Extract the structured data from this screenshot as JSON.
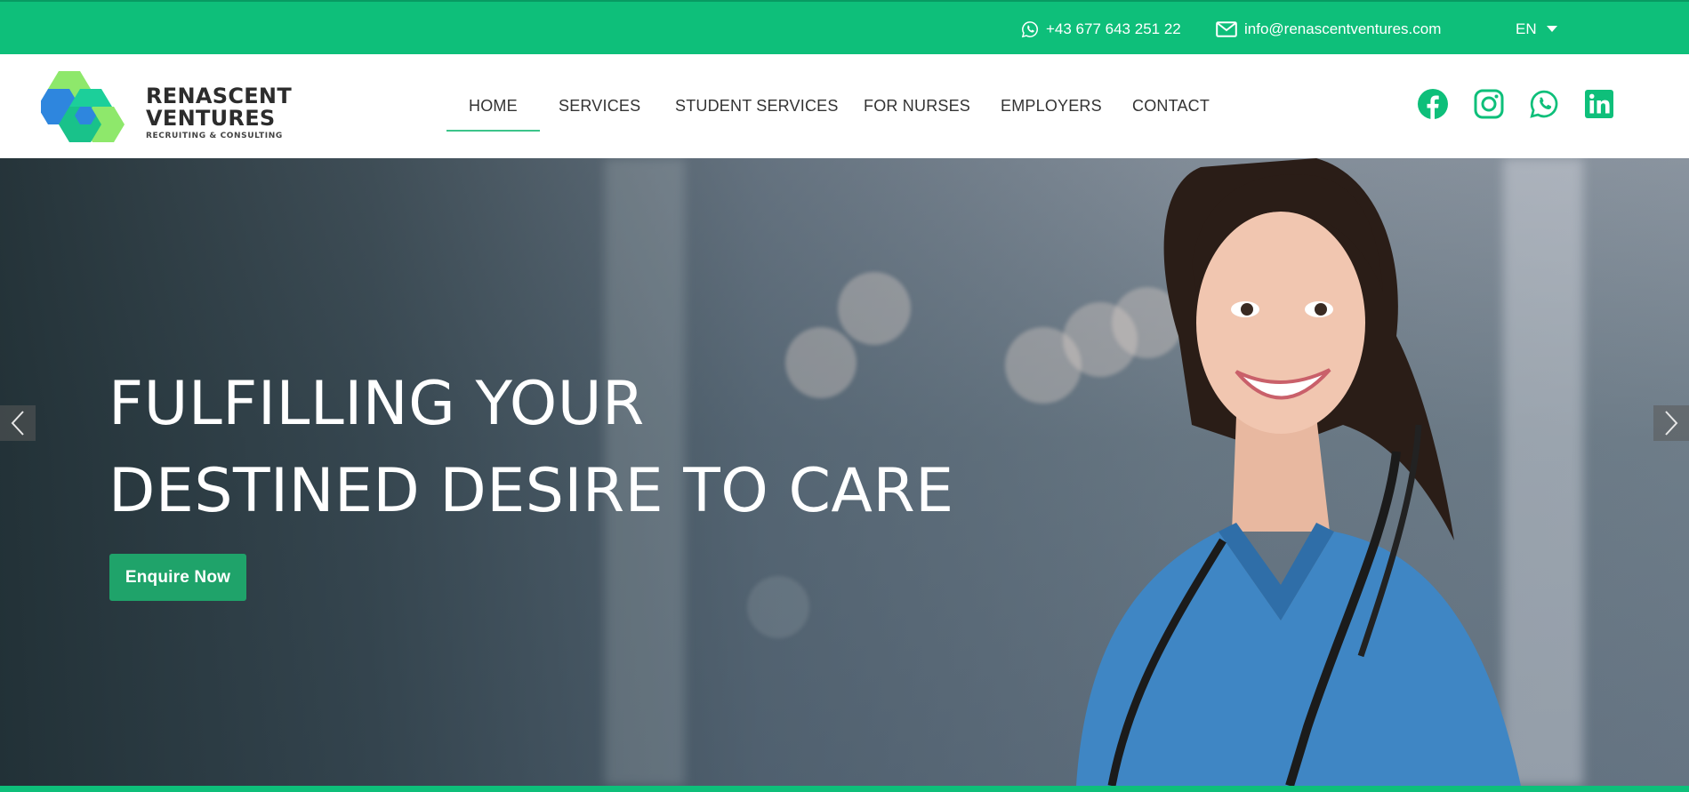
{
  "topbar": {
    "phone": "+43 677 643 251 22",
    "email": "info@renascentventures.com",
    "language": "EN",
    "icons": {
      "phone": "whatsapp-icon",
      "email": "envelope-icon",
      "language": "chevron-down-icon"
    },
    "color": "#0ebf7a"
  },
  "logo": {
    "line1": "RENASCENT",
    "line2": "VENTURES",
    "tagline": "RECRUITING & CONSULTING"
  },
  "nav": {
    "items": [
      {
        "label": "HOME",
        "active": true
      },
      {
        "label": "SERVICES"
      },
      {
        "label": "STUDENT SERVICES"
      },
      {
        "label": "FOR NURSES"
      },
      {
        "label": "EMPLOYERS"
      },
      {
        "label": "CONTACT"
      }
    ]
  },
  "social": {
    "icons": [
      "facebook-icon",
      "instagram-icon",
      "whatsapp-icon",
      "linkedin-icon"
    ],
    "color": "#0ebf7a"
  },
  "hero": {
    "headline_line1": "FULFILLING YOUR",
    "headline_line2": "DESTINED DESIRE TO CARE",
    "cta_label": "Enquire Now",
    "cta_color": "#1fa36a",
    "prev_icon": "chevron-left-icon",
    "next_icon": "chevron-right-icon"
  }
}
